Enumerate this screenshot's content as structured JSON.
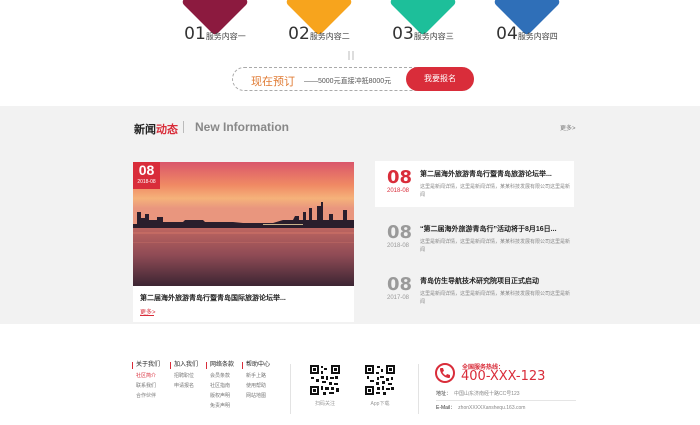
{
  "services": [
    {
      "num": "01",
      "label": "服务内容一",
      "color": "#8c1a3f"
    },
    {
      "num": "02",
      "label": "服务内容二",
      "color": "#f7a41d"
    },
    {
      "num": "03",
      "label": "服务内容三",
      "color": "#1dbf9a"
    },
    {
      "num": "04",
      "label": "服务内容四",
      "color": "#2f6fb8"
    }
  ],
  "banner": {
    "highlight": "现在预订",
    "text": "——5000元直接冲抵8000元",
    "button": "我要报名"
  },
  "news": {
    "title_black": "新闻",
    "title_red": "动态",
    "title_en": "New Information",
    "more": "更多>",
    "feature": {
      "day": "08",
      "ym": "2018-08",
      "title": "第二届海外旅游青岛行暨青岛国际旅游论坛举...",
      "more": "更多>"
    },
    "items": [
      {
        "day": "08",
        "ym": "2018-08",
        "title": "第二届海外旅游青岛行暨青岛旅游论坛举...",
        "desc": "这里是新闻详情，这里是新闻详情，某某科技发展有限公司这里是新闻"
      },
      {
        "day": "08",
        "ym": "2018-08",
        "title": "“第二届海外旅游青岛行”活动将于8月16日...",
        "desc": "这里是新闻详情，这里是新闻详情，某某科技发展有限公司这里是新闻"
      },
      {
        "day": "08",
        "ym": "2017-08",
        "title": "青岛仿生导航技术研究院项目正式启动",
        "desc": "这里是新闻详情，这里是新闻详情，某某科技发展有限公司这里是新闻"
      }
    ]
  },
  "footer": {
    "columns": [
      {
        "head": "关于我们",
        "items": [
          "社区简介",
          "联系我们",
          "合作伙伴"
        ]
      },
      {
        "head": "加入我们",
        "items": [
          "招聘职位",
          "申请报名"
        ]
      },
      {
        "head": "网络条款",
        "items": [
          "会员条款",
          "社区指南",
          "版权声明",
          "免责声明"
        ]
      },
      {
        "head": "帮助中心",
        "items": [
          "新手上路",
          "使用帮助",
          "网站地图"
        ]
      }
    ],
    "qr": [
      {
        "caption": "扫码关注"
      },
      {
        "caption": "App下载"
      }
    ],
    "hotline_label": "全国服务热线：",
    "hotline": "400-XXX-123",
    "address_key": "地址：",
    "address": "中国山东济南经十路CC号123",
    "email_key": "E-Mail：",
    "email": "zhonXXXXXanshequ.163.com"
  }
}
